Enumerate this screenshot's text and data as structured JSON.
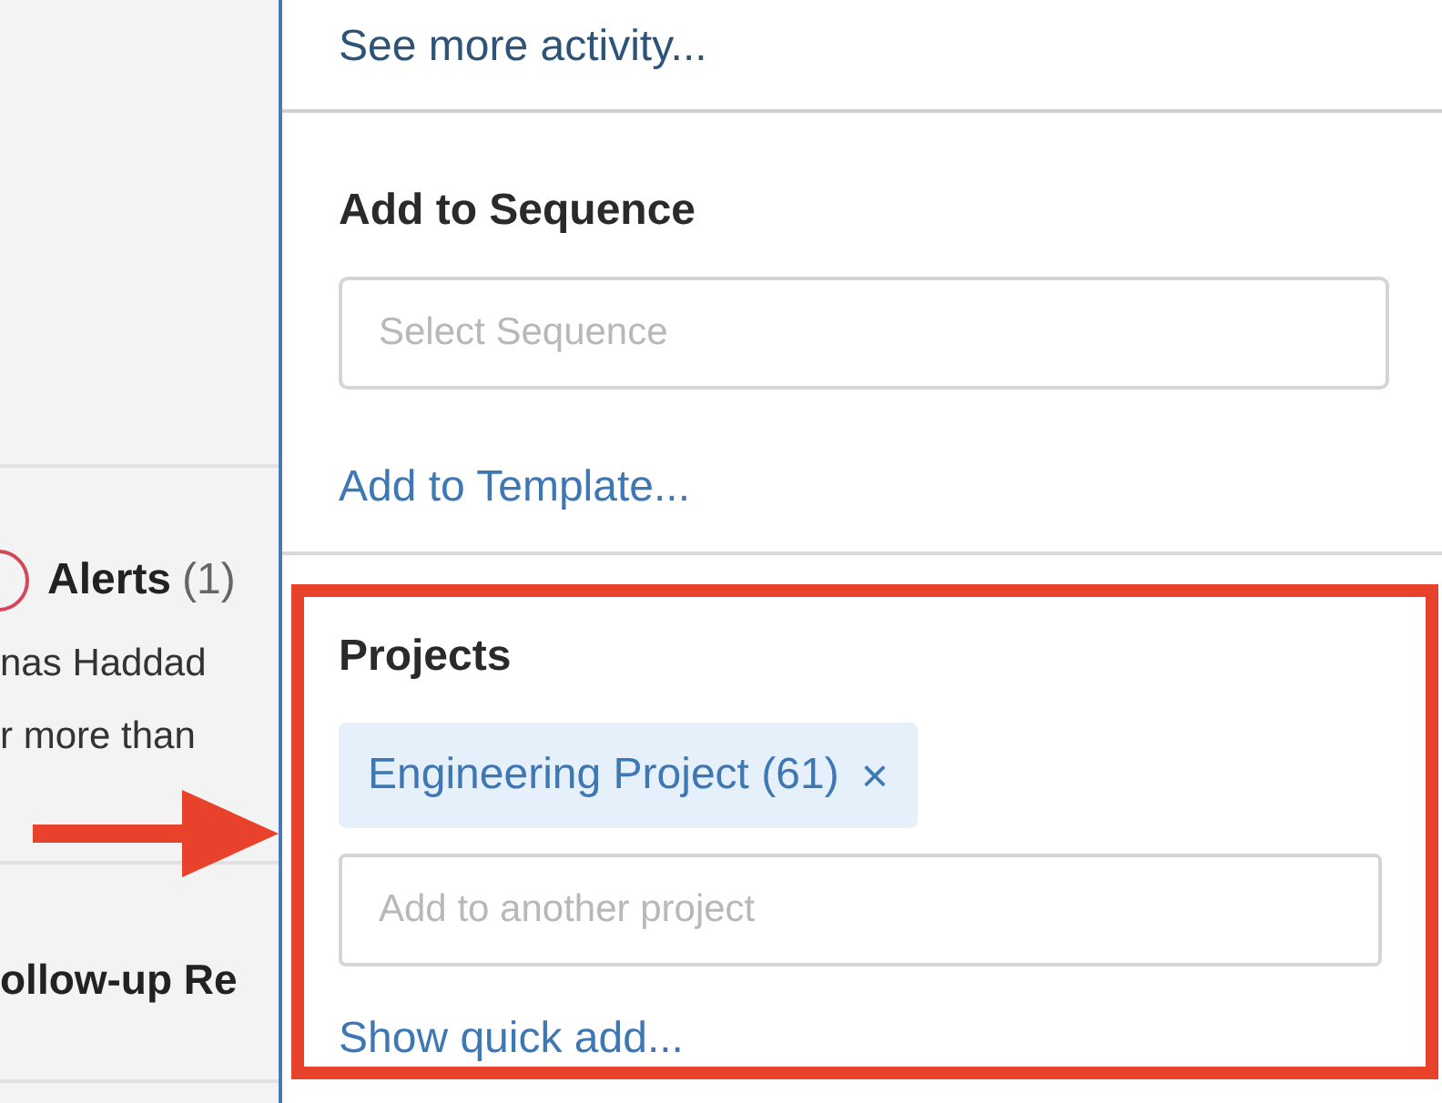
{
  "left_panel": {
    "alerts": {
      "title": "Alerts",
      "count": "(1)",
      "lines": [
        "nas Haddad",
        "r more than"
      ]
    },
    "follow_up": {
      "title": "ollow-up Re"
    }
  },
  "side_panel": {
    "activity_link": "See more activity...",
    "sequence": {
      "heading": "Add to Sequence",
      "placeholder": "Select Sequence",
      "template_link": "Add to Template..."
    },
    "projects": {
      "heading": "Projects",
      "tags": [
        {
          "label": "Engineering Project (61)",
          "remove": "×"
        }
      ],
      "placeholder": "Add to another project",
      "quick_add_link": "Show quick add..."
    }
  }
}
